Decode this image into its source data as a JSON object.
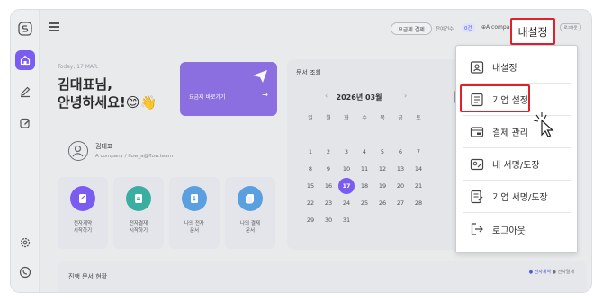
{
  "topbar": {
    "plan_button": "요금제 결제",
    "remaining_label": "잔여건수",
    "remaining_count": "0건",
    "account": "A company / fl",
    "my_settings": "내설정",
    "logout_mini": "로그아웃"
  },
  "greeting": {
    "date": "Today, 17 MAR.",
    "line1": "김대표님,",
    "line2": "안녕하세요!😊👋",
    "plan_card_label": "요금제 바로가기",
    "plan_card_arrow": "→"
  },
  "profile": {
    "name": "김대표",
    "company": "A company / flow_a@flow.team"
  },
  "tiles": [
    {
      "line1": "전자계약",
      "line2": "시작하기",
      "color": "#7b5cf0"
    },
    {
      "line1": "전자결재",
      "line2": "시작하기",
      "color": "#3aaea0"
    },
    {
      "line1": "나의 전자",
      "line2": "문서",
      "color": "#5aa0e0"
    },
    {
      "line1": "나의 결재",
      "line2": "문서",
      "color": "#5aa0e0"
    }
  ],
  "docpanel": {
    "title": "문서 조회",
    "month": "2026년 03월",
    "prev": "‹",
    "next": "›",
    "weekdays": [
      "일",
      "월",
      "화",
      "수",
      "목",
      "금",
      "토"
    ],
    "weeks": [
      [
        "1",
        "2",
        "3",
        "4",
        "5",
        "6",
        "7"
      ],
      [
        "8",
        "9",
        "10",
        "11",
        "12",
        "13",
        "14"
      ],
      [
        "15",
        "16",
        "17",
        "18",
        "19",
        "20",
        "21"
      ],
      [
        "22",
        "23",
        "24",
        "25",
        "26",
        "27",
        "28"
      ],
      [
        "29",
        "30",
        "31",
        "",
        "",
        "",
        ""
      ]
    ],
    "today": "17"
  },
  "bottom": {
    "title": "진행 문서 현황",
    "legend_contract": "● 전자계약",
    "legend_approval": "● 전자결재"
  },
  "menu": {
    "items": [
      {
        "label": "내설정",
        "icon": "user-card-icon"
      },
      {
        "label": "기업 설정",
        "icon": "building-doc-icon"
      },
      {
        "label": "결제 관리",
        "icon": "card-payment-icon"
      },
      {
        "label": "내 서명/도장",
        "icon": "signature-icon"
      },
      {
        "label": "기업 서명/도장",
        "icon": "stamp-doc-icon"
      },
      {
        "label": "로그아웃",
        "icon": "logout-icon"
      }
    ]
  },
  "colors": {
    "accent": "#7b5cf0",
    "highlight": "#e2202a"
  }
}
